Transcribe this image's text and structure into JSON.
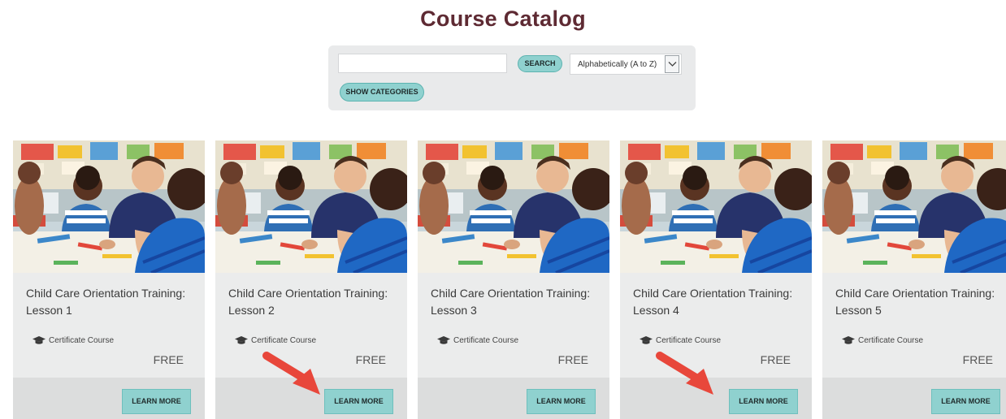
{
  "page": {
    "title": "Course Catalog"
  },
  "search": {
    "placeholder": "",
    "button_label": "SEARCH",
    "sort_value": "Alphabetically (A to Z)",
    "categories_label": "SHOW CATEGORIES"
  },
  "courses": [
    {
      "title": "Child Care Orientation Training: Lesson 1",
      "type": "Certificate Course",
      "price": "FREE",
      "button": "LEARN MORE"
    },
    {
      "title": "Child Care Orientation Training: Lesson 2",
      "type": "Certificate Course",
      "price": "FREE",
      "button": "LEARN MORE"
    },
    {
      "title": "Child Care Orientation Training: Lesson 3",
      "type": "Certificate Course",
      "price": "FREE",
      "button": "LEARN MORE"
    },
    {
      "title": "Child Care Orientation Training: Lesson 4",
      "type": "Certificate Course",
      "price": "FREE",
      "button": "LEARN MORE"
    },
    {
      "title": "Child Care Orientation Training: Lesson 5",
      "type": "Certificate Course",
      "price": "FREE",
      "button": "LEARN MORE"
    }
  ],
  "colors": {
    "title": "#5e2a33",
    "button": "#8fd1cf",
    "card_bg": "#ebecec",
    "annotation_arrow": "#e8473b"
  },
  "icons": {
    "certificate": "graduation-cap-icon",
    "dropdown": "chevron-down-icon",
    "annotation": "red-arrow-icon"
  }
}
